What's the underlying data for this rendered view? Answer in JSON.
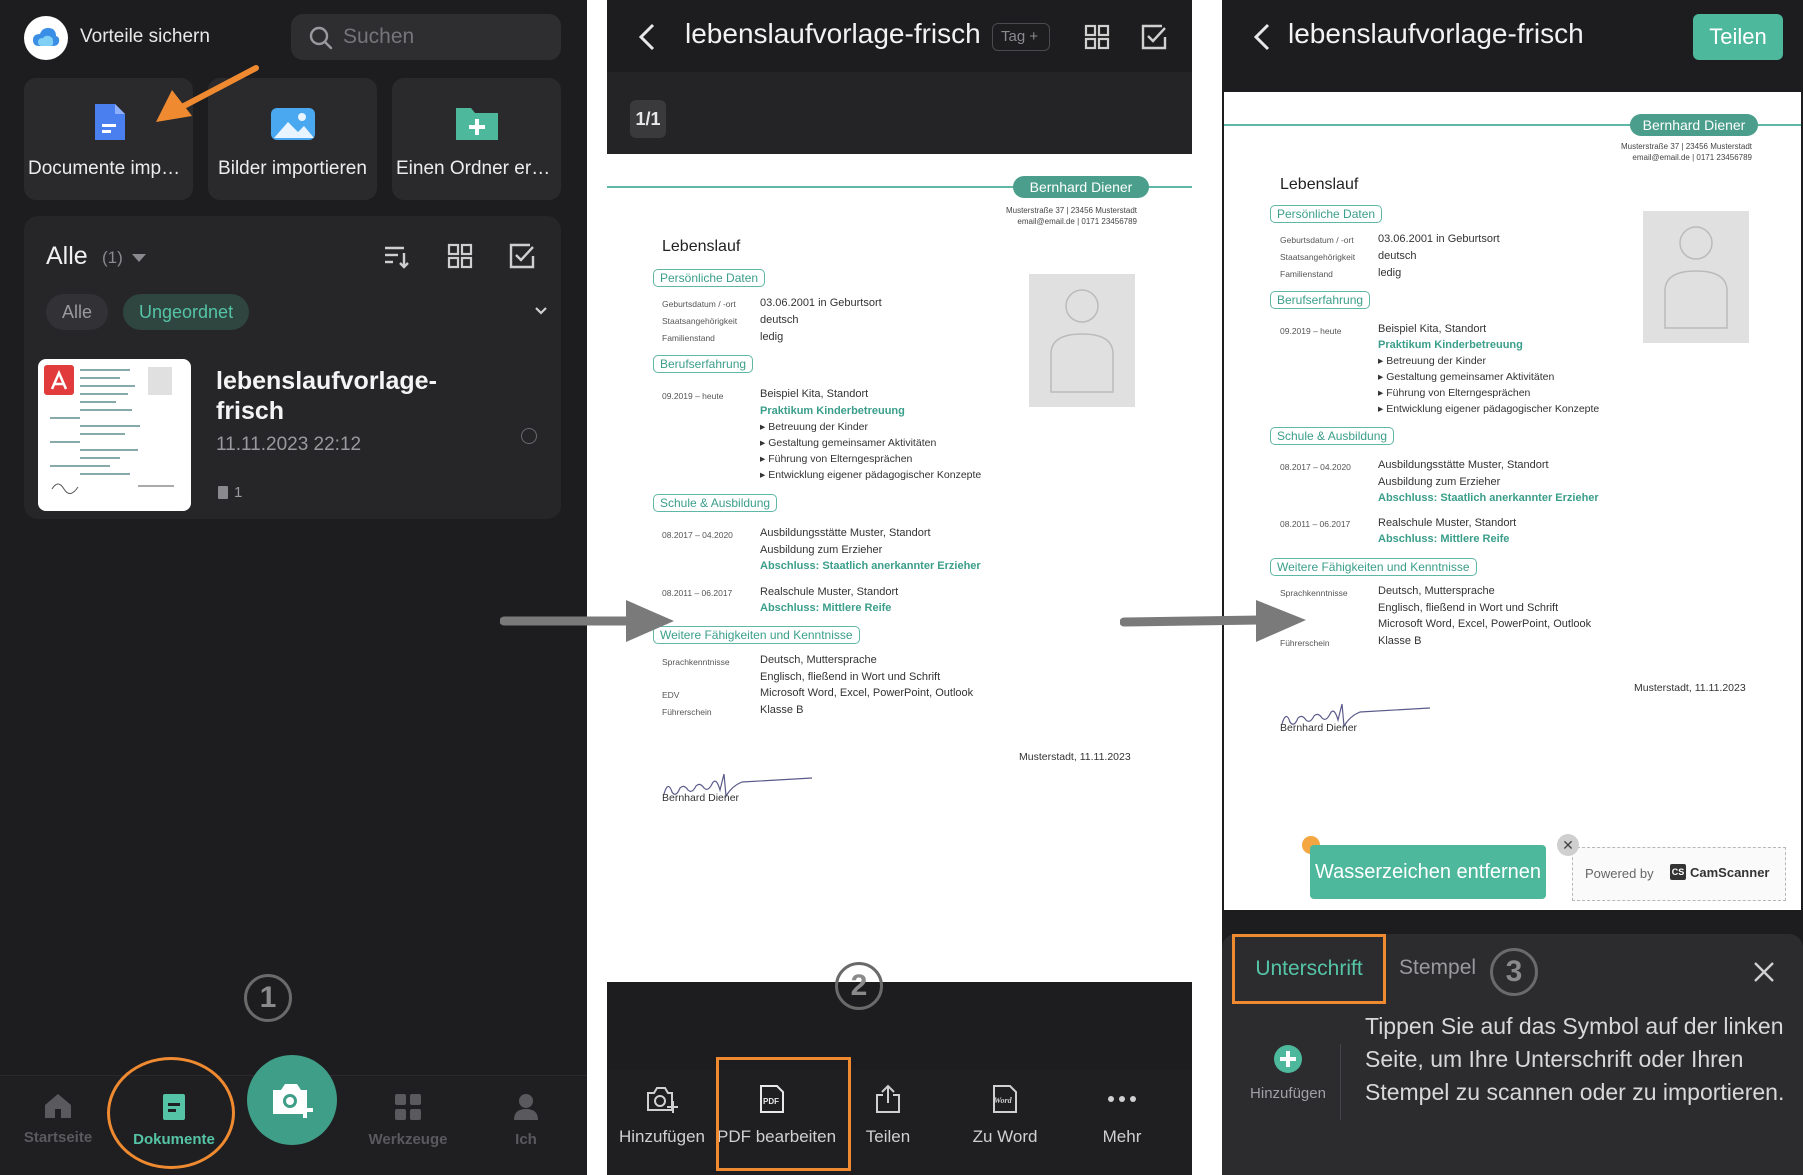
{
  "panel1": {
    "header_title": "Vorteile sichern",
    "search_placeholder": "Suchen",
    "import_cards": [
      {
        "label": "Documente impor..."
      },
      {
        "label": "Bilder importieren"
      },
      {
        "label": "Einen Ordner erst..."
      }
    ],
    "folder_title": "Alle",
    "folder_count": "(1)",
    "chips": [
      "Alle",
      "Ungeordnet"
    ],
    "document": {
      "name": "lebenslaufvorlage-frisch",
      "date": "11.11.2023 22:12",
      "pages": "1"
    },
    "step": "1",
    "nav": [
      {
        "label": "Startseite"
      },
      {
        "label": "Dokumente"
      },
      {
        "label": "Werkzeuge"
      },
      {
        "label": "Ich"
      }
    ]
  },
  "panel2": {
    "title": "lebenslaufvorlage-frisch",
    "tag_label": "Tag",
    "page_indicator": "1/1",
    "step": "2",
    "tools": [
      {
        "label": "Hinzufügen"
      },
      {
        "label": "PDF bearbeiten"
      },
      {
        "label": "Teilen"
      },
      {
        "label": "Zu Word"
      },
      {
        "label": "Mehr"
      }
    ]
  },
  "panel3": {
    "title": "lebenslaufvorlage-frisch",
    "share_label": "Teilen",
    "watermark_button": "Wasserzeichen entfernen",
    "powered_by": "Powered by",
    "brand": "CamScanner",
    "brand_short": "CS",
    "tabs": [
      "Unterschrift",
      "Stempel"
    ],
    "step": "3",
    "add_label": "Hinzufügen",
    "hint": "Tippen Sie auf das Symbol auf der linken Seite, um Ihre Unterschrift oder Ihren Stempel zu scannen oder zu importieren."
  },
  "resume": {
    "name": "Bernhard Diener",
    "address": "Musterstraße 37 | 23456 Musterstadt",
    "contact": "email@email.de | 0171 23456789",
    "title": "Lebenslauf",
    "sections": {
      "personal": "Persönliche Daten",
      "work": "Berufserfahrung",
      "school": "Schule & Ausbildung",
      "skills": "Weitere Fähigkeiten und Kenntnisse"
    },
    "personal": [
      {
        "label": "Geburtsdatum / -ort",
        "value": "03.06.2001 in Geburtsort"
      },
      {
        "label": "Staatsangehörigkeit",
        "value": "deutsch"
      },
      {
        "label": "Familienstand",
        "value": "ledig"
      }
    ],
    "work": {
      "period": "09.2019 – heute",
      "place": "Beispiel Kita, Standort",
      "role": "Praktikum Kinderbetreuung",
      "bullets": [
        "Betreuung der Kinder",
        "Gestaltung gemeinsamer Aktivitäten",
        "Führung von Elterngesprächen",
        "Entwicklung eigener pädagogischer Konzepte"
      ]
    },
    "school": [
      {
        "period": "08.2017 – 04.2020",
        "line1": "Ausbildungsstätte Muster, Standort",
        "line2": "Ausbildung zum Erzieher",
        "highlight": "Abschluss: Staatlich anerkannter Erzieher"
      },
      {
        "period": "08.2011 – 06.2017",
        "line1": "Realschule Muster, Standort",
        "highlight": "Abschluss: Mittlere Reife"
      }
    ],
    "skills": [
      {
        "label": "Sprachkenntnisse",
        "value": "Deutsch, Muttersprache"
      },
      {
        "label": "",
        "value": "Englisch, fließend in Wort und Schrift"
      },
      {
        "label": "EDV",
        "value": "Microsoft Word, Excel, PowerPoint, Outlook"
      },
      {
        "label": "Führerschein",
        "value": "Klasse B"
      }
    ],
    "place_date": "Musterstadt, 11.11.2023",
    "signature_name": "Bernhard Diener"
  },
  "colors": {
    "accent": "#4db89c",
    "highlight": "#f08a30",
    "background": "#1d1d1f"
  }
}
